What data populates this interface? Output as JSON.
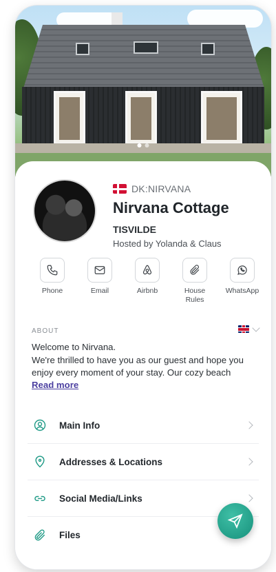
{
  "property": {
    "code": "DK:NIRVANA",
    "name": "Nirvana Cottage",
    "location": "TISVILDE",
    "host": "Hosted by Yolanda & Claus"
  },
  "hero": {
    "slide_count": 2,
    "active_slide": 1
  },
  "actions": [
    {
      "label": "Phone",
      "icon": "phone-icon"
    },
    {
      "label": "Email",
      "icon": "email-icon"
    },
    {
      "label": "Airbnb",
      "icon": "airbnb-icon"
    },
    {
      "label": "House\nRules",
      "icon": "paperclip-icon"
    },
    {
      "label": "WhatsApp",
      "icon": "whatsapp-icon"
    }
  ],
  "about": {
    "heading": "ABOUT",
    "language": "English",
    "text": "Welcome to Nirvana.\nWe're thrilled to have you as our guest and hope you enjoy every moment of your stay. Our cozy beach",
    "read_more": "Read more"
  },
  "menu": [
    {
      "label": "Main Info",
      "icon": "user-circle-icon"
    },
    {
      "label": "Addresses & Locations",
      "icon": "location-pin-icon"
    },
    {
      "label": "Social Media/Links",
      "icon": "link-icon"
    },
    {
      "label": "Files",
      "icon": "paperclip-icon"
    }
  ],
  "colors": {
    "accent": "#1f9a86",
    "link": "#4b3fa0",
    "fab": "#17917c"
  }
}
